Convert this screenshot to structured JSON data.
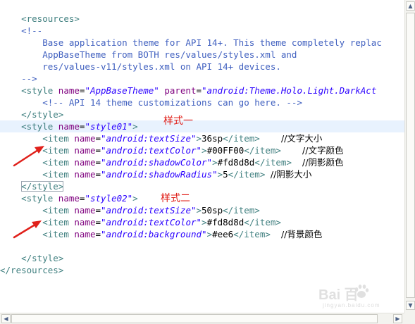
{
  "code": {
    "l1": {
      "open": "<resources>"
    },
    "l3": {
      "text": "<!--"
    },
    "l4": {
      "text": "Base application theme for API 14+. This theme completely replac"
    },
    "l5": {
      "text": "AppBaseTheme from BOTH res/values/styles.xml and"
    },
    "l6": {
      "text": "res/values-v11/styles.xml on API 14+ devices."
    },
    "l7": {
      "text": "-->"
    },
    "l8": {
      "tag": "<style",
      "a1": "name",
      "v1": "\"AppBaseTheme\"",
      "a2": "parent",
      "v2": "\"android:Theme.Holo.Light.DarkAct"
    },
    "l9": {
      "text": "<!-- API 14 theme customizations can go here. -->"
    },
    "l10": {
      "text": "</style>"
    },
    "l11": {
      "tag": "<style",
      "a1": "name",
      "v1": "\"style01\"",
      "close": ">"
    },
    "l12": {
      "tag": "<item",
      "a1": "name",
      "v1": "\"android:textSize\"",
      "gt": ">",
      "val": "36sp",
      "end": "</item>",
      "comment": "//文字大小"
    },
    "l13": {
      "tag": "<item",
      "a1": "name",
      "v1": "\"android:textColor\"",
      "gt": ">",
      "val": "#00FF00",
      "end": "</item>",
      "comment": "//文字颜色"
    },
    "l14": {
      "tag": "<item",
      "a1": "name",
      "v1": "\"android:shadowColor\"",
      "gt": ">",
      "val": "#fd8d8d",
      "end": "</item>",
      "comment": "//阴影颜色"
    },
    "l15": {
      "tag": "<item",
      "a1": "name",
      "v1": "\"android:shadowRadius\"",
      "gt": ">",
      "val": "5",
      "end": "</item>",
      "comment": "//阴影大小"
    },
    "l16": {
      "text": "</style>"
    },
    "l17": {
      "tag": "<style",
      "a1": "name",
      "v1": "\"style02\"",
      "close": ">"
    },
    "l18": {
      "tag": "<item",
      "a1": "name",
      "v1": "\"android:textSize\"",
      "gt": ">",
      "val": "50sp",
      "end": "</item>"
    },
    "l19": {
      "tag": "<item",
      "a1": "name",
      "v1": "\"android:textColor\"",
      "gt": ">",
      "val": "#fd8d8d",
      "end": "</item>"
    },
    "l20": {
      "tag": "<item",
      "a1": "name",
      "v1": "\"android:background\"",
      "gt": ">",
      "val": "#ee6",
      "end": "</item>",
      "comment": "//背景颜色"
    },
    "l22": {
      "text": "</style>"
    },
    "l23": {
      "close": "</resources>"
    }
  },
  "annotations": {
    "style1_label": "样式一",
    "style2_label": "样式二"
  },
  "scrollbar": {
    "up": "▲",
    "down": "▼",
    "left": "◀",
    "right": "▶"
  },
  "watermark": {
    "brand": "Bai  百",
    "sub": "jingyan.baidu.com"
  },
  "colors": {
    "tag": "#3f7f7f",
    "attr_name": "#7f007f",
    "attr_value": "#2a00ff",
    "comment": "#3f5fbf",
    "annotation": "#e0201a",
    "current_line": "#e8f2fe"
  }
}
